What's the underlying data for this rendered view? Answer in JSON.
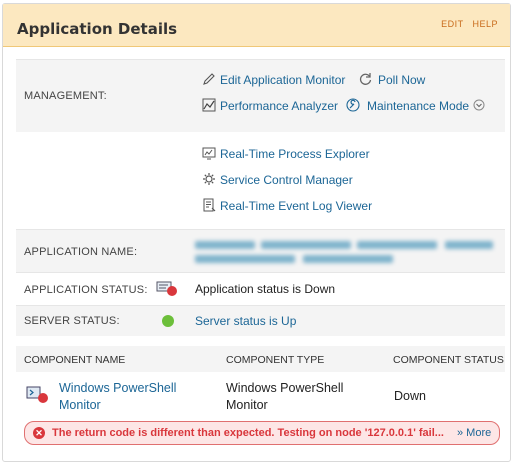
{
  "header": {
    "title": "Application Details",
    "edit_label": "EDIT",
    "help_label": "HELP"
  },
  "management": {
    "label": "MANAGEMENT:",
    "actions": [
      {
        "label": "Edit Application Monitor",
        "icon": "pencil-icon"
      },
      {
        "label": "Poll Now",
        "icon": "refresh-icon"
      },
      {
        "label": "Performance Analyzer",
        "icon": "performance-icon"
      },
      {
        "label": "Maintenance Mode",
        "icon": "wrench-icon"
      },
      {
        "label": "Real-Time Process Explorer",
        "icon": "process-explorer-icon"
      },
      {
        "label": "Service Control Manager",
        "icon": "gear-icon"
      },
      {
        "label": "Real-Time Event Log Viewer",
        "icon": "event-log-icon"
      }
    ]
  },
  "application_name": {
    "label": "APPLICATION NAME:"
  },
  "application_status": {
    "label": "APPLICATION STATUS:",
    "value": "Application status is Down",
    "color": "#d9373c"
  },
  "server_status": {
    "label": "SERVER STATUS:",
    "value": "Server status is Up",
    "color": "#6cbf3a"
  },
  "components": {
    "headers": [
      "COMPONENT NAME",
      "COMPONENT TYPE",
      "COMPONENT STATUS"
    ],
    "rows": [
      {
        "name_line1": "Windows PowerShell",
        "name_line2": "Monitor",
        "type_line1": "Windows PowerShell",
        "type_line2": "Monitor",
        "status": "Down"
      }
    ]
  },
  "error": {
    "message": "The return code is different than expected. Testing on node '127.0.0.1' fail...",
    "more_label": "» More"
  }
}
